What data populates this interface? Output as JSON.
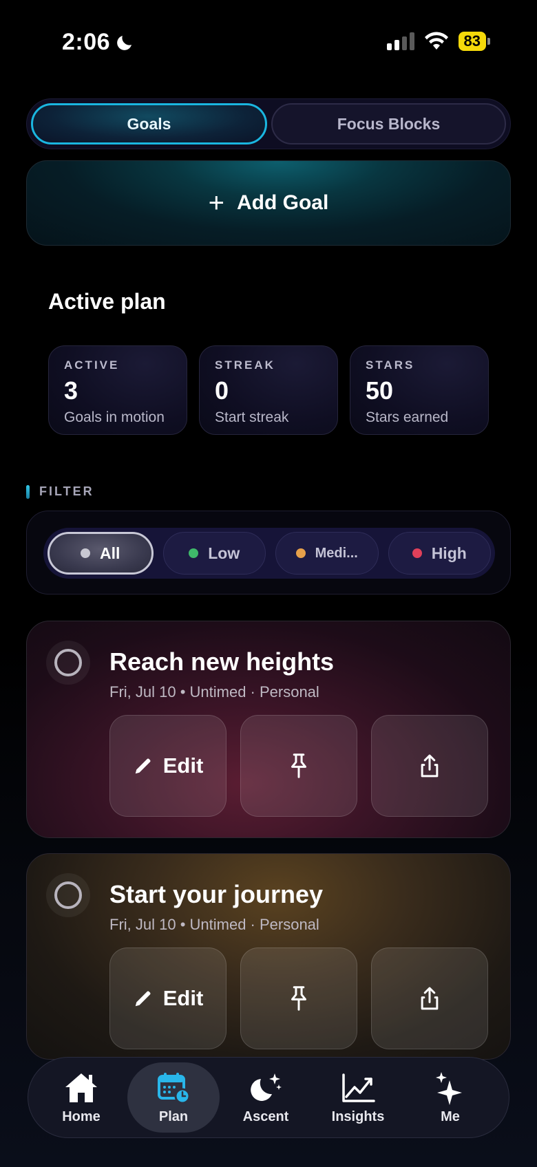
{
  "status": {
    "time": "2:06",
    "battery": "83"
  },
  "segments": [
    {
      "label": "Goals",
      "active": true
    },
    {
      "label": "Focus Blocks",
      "active": false
    }
  ],
  "add_goal": {
    "label": "Add Goal"
  },
  "section_title": "Active plan",
  "stats": [
    {
      "label": "ACTIVE",
      "value": "3",
      "sub": "Goals in motion"
    },
    {
      "label": "STREAK",
      "value": "0",
      "sub": "Start streak"
    },
    {
      "label": "STARS",
      "value": "50",
      "sub": "Stars earned"
    }
  ],
  "filter": {
    "label": "FILTER",
    "chips": [
      {
        "label": "All",
        "color": "#c8c8d2"
      },
      {
        "label": "Low",
        "color": "#3fba6a"
      },
      {
        "label": "Medi...",
        "color": "#e7a14a"
      },
      {
        "label": "High",
        "color": "#e0405a"
      }
    ]
  },
  "goals": [
    {
      "title": "Reach new heights",
      "meta": "Fri, Jul 10 • Untimed · Personal",
      "edit_label": "Edit"
    },
    {
      "title": "Start your journey",
      "meta": "Fri, Jul 10 • Untimed · Personal",
      "edit_label": "Edit"
    }
  ],
  "nav": [
    {
      "label": "Home",
      "icon": "home-icon"
    },
    {
      "label": "Plan",
      "icon": "calendar-clock-icon"
    },
    {
      "label": "Ascent",
      "icon": "moon-stars-icon"
    },
    {
      "label": "Insights",
      "icon": "chart-line-icon"
    },
    {
      "label": "Me",
      "icon": "sparkles-icon"
    }
  ],
  "colors": {
    "accent": "#1ab6e0"
  }
}
